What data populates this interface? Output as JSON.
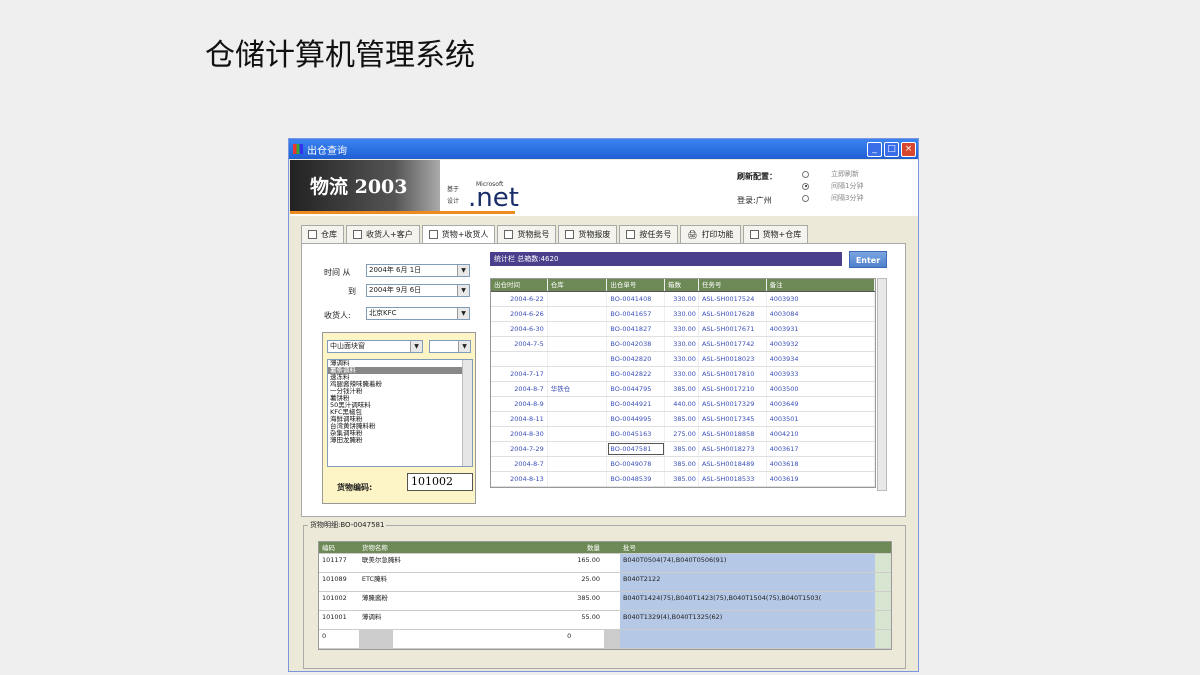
{
  "slide": {
    "title": "仓储计算机管理系统"
  },
  "window": {
    "title": "出仓查询"
  },
  "banner": {
    "brand": "物流 2003",
    "by_label": "基于",
    "design_label": "设计",
    "ms_label": "Microsoft",
    "net_logo": ".net",
    "refresh_label": "刷新配置：",
    "login_label": "登录:广州",
    "refresh_options": [
      "立即刷新",
      "间隔1分钟",
      "间隔3分钟"
    ]
  },
  "tabs": [
    "仓库",
    "收货人+客户",
    "货物+收货人",
    "货物批号",
    "货物报废",
    "按任务号",
    "打印功能",
    "货物+仓库"
  ],
  "filters": {
    "time_from_label": "时间 从",
    "time_from_value": "2004年 6月 1日",
    "time_to_label": "到",
    "time_to_value": "2004年 9月 6日",
    "receiver_label": "收货人:",
    "receiver_value": "北京KFC",
    "category_value": "中山面块窗",
    "items": [
      "薄调料",
      "薯条调料",
      "速冻料",
      "鸡腿酱辣味腌着粉",
      "一分钱汁粉",
      "薯饼粉",
      "50黑汁调味料",
      "KFC黑椒包",
      "海鲜调味粉",
      "台湾黄饼腌料粉",
      "杂集调味粉",
      "薄田龙腌粉"
    ],
    "code_label": "货物编码:",
    "code_value": "101002"
  },
  "stats": {
    "text": "统计栏    总箱数:4620",
    "enter": "Enter"
  },
  "out_table": {
    "headers": [
      "出仓时间",
      "仓库",
      "出仓单号",
      "箱数",
      "任务号",
      "备注"
    ],
    "warehouse": "华铁仓",
    "rows": [
      [
        "2004-6-22",
        "BO-0041408",
        "330.00",
        "ASL-SH0017524",
        "4003930"
      ],
      [
        "2004-6-26",
        "BO-0041657",
        "330.00",
        "ASL-SH0017628",
        "4003084"
      ],
      [
        "2004-6-30",
        "BO-0041827",
        "330.00",
        "ASL-SH0017671",
        "4003931"
      ],
      [
        "2004-7-5",
        "BO-0042038",
        "330.00",
        "ASL-SH0017742",
        "4003932"
      ],
      [
        "",
        "BO-0042820",
        "330.00",
        "ASL-SH0018023",
        "4003934"
      ],
      [
        "2004-7-17",
        "BO-0042822",
        "330.00",
        "ASL-SH0017810",
        "4003933"
      ],
      [
        "2004-8-7",
        "BO-0044795",
        "385.00",
        "ASL-SH0017210",
        "4003500"
      ],
      [
        "2004-8-9",
        "BO-0044921",
        "440.00",
        "ASL-SH0017329",
        "4003649"
      ],
      [
        "2004-8-11",
        "BO-0044995",
        "385.00",
        "ASL-SH0017345",
        "4003501"
      ],
      [
        "2004-8-30",
        "BO-0045163",
        "275.00",
        "ASL-SH0018858",
        "4004210"
      ],
      [
        "2004-7-29",
        "BO-0047581",
        "385.00",
        "ASL-SH0018273",
        "4003617"
      ],
      [
        "2004-8-7",
        "BO-0049078",
        "385.00",
        "ASL-SH0018489",
        "4003618"
      ],
      [
        "2004-8-13",
        "BO-0048539",
        "385.00",
        "ASL-SH0018533",
        "4003619"
      ]
    ]
  },
  "details": {
    "title": "货物明细:BO-0047581",
    "headers": [
      "编码",
      "货物名称",
      "数量",
      "",
      "批号"
    ],
    "rows": [
      [
        "101177",
        "联美尔急腌料",
        "165.00",
        "B040T0504(74),B040T0506(91)"
      ],
      [
        "101089",
        "ETC腌料",
        "25.00",
        "B040T2122"
      ],
      [
        "101002",
        "薄腌酱粉",
        "385.00",
        "B040T1424(75),B040T1423(75),B040T1504(75),B040T1503("
      ],
      [
        "101001",
        "薄调料",
        "55.00",
        "B040T1329(4),B040T1325(62)"
      ],
      [
        "0",
        "",
        "0",
        ""
      ]
    ]
  }
}
